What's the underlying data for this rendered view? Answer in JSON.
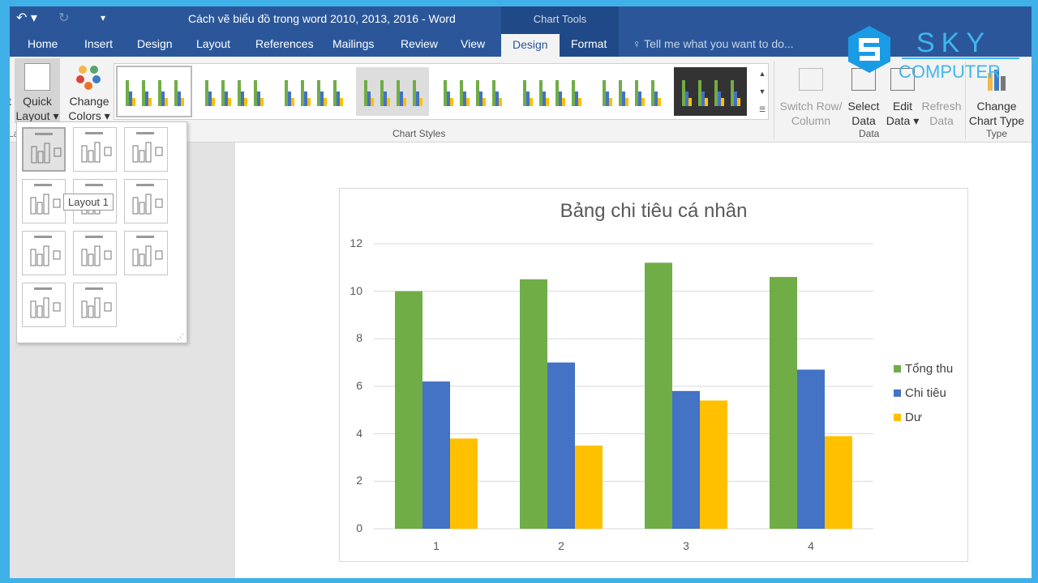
{
  "window": {
    "title": "Cách vẽ biểu đồ trong word 2010, 2013, 2016 - Word",
    "context_tab_group": "Chart Tools"
  },
  "tabs": [
    "Home",
    "Insert",
    "Design",
    "Layout",
    "References",
    "Mailings",
    "Review",
    "View",
    "Design",
    "Format"
  ],
  "active_tab": "Design",
  "tell_me": "Tell me what you want to do...",
  "ribbon": {
    "quick_layout": [
      "Quick",
      "Layout ▾"
    ],
    "change_colors": [
      "Change",
      "Colors ▾"
    ],
    "chart_styles_label": "Chart Styles",
    "switch": [
      "Switch Row/",
      "Column"
    ],
    "select": [
      "Select",
      "Data"
    ],
    "edit": [
      "Edit",
      "Data ▾"
    ],
    "refresh": [
      "Refresh",
      "Data"
    ],
    "data_label": "Data",
    "change_type": [
      "Change",
      "Chart Type"
    ],
    "type_label": "Type",
    "layouts_label_partial": "La",
    "left_partial": "t"
  },
  "quick_layout_tooltip": "Layout 1",
  "logo": {
    "text1": "SKY",
    "text2": "COMPUTER"
  },
  "colors": {
    "accent": "#2b579a",
    "green": "#70ad47",
    "blue": "#4472c4",
    "yellow": "#ffc000"
  },
  "chart_data": {
    "type": "bar",
    "title": "Bảng chi tiêu cá nhân",
    "categories": [
      "1",
      "2",
      "3",
      "4"
    ],
    "ylim": [
      0,
      12
    ],
    "yticks": [
      "0",
      "2",
      "4",
      "6",
      "8",
      "10",
      "12"
    ],
    "grid": true,
    "legend": "right",
    "series": [
      {
        "name": "Tổng thu",
        "color": "#70ad47",
        "values": [
          10,
          10.5,
          11.2,
          10.6
        ]
      },
      {
        "name": "Chi tiêu",
        "color": "#4472c4",
        "values": [
          6.2,
          7,
          5.8,
          6.7
        ]
      },
      {
        "name": "Dư",
        "color": "#ffc000",
        "values": [
          3.8,
          3.5,
          5.4,
          3.9
        ]
      }
    ]
  }
}
